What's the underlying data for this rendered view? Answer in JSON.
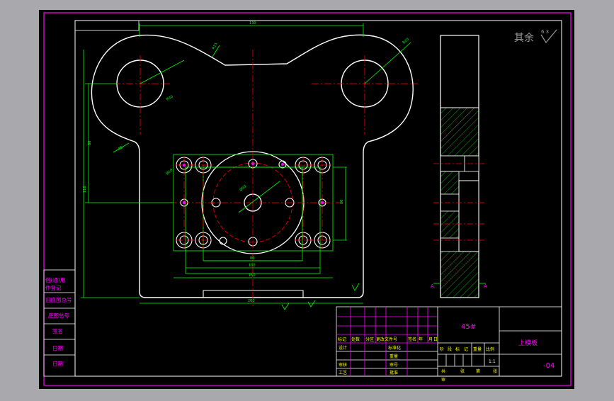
{
  "drawing": {
    "surface_note": "其余",
    "roughness": "6.3",
    "material": "45#",
    "part_name": "上模板",
    "drawing_number": "-04",
    "scale": "1:1"
  },
  "side_labels": [
    "借(通)用",
    "件登记",
    "旧底图总号",
    "底图总号",
    "签名",
    "日期",
    "日期"
  ],
  "title_block": {
    "rev_headers": [
      "标记",
      "处数",
      "分区",
      "更改文件号",
      "签名",
      "年",
      "月",
      "日"
    ],
    "left_rows": [
      "设计",
      "审核",
      "工艺"
    ],
    "mid_rows": [
      "标准化",
      "重量",
      "审号",
      "批准"
    ],
    "right_headers": [
      "阶",
      "段",
      "标",
      "记",
      "重量",
      "比例"
    ],
    "sheets": [
      "共",
      "张",
      "第",
      "张"
    ],
    "extra": "审"
  },
  "dims": {
    "top_width": "130",
    "r_arc_left": "R15",
    "r_arc_right": "R20",
    "r_circle_left": "R40",
    "r_corner": "R5",
    "left_height_top": "86",
    "left_height_total": "116",
    "center_dia": "Ø50",
    "hole_dia": "Ø10",
    "bottom_w1": "80",
    "bottom_w2": "130",
    "bottom_w3": "150",
    "bottom_w4": "200",
    "right_h": "80",
    "section_a": "A",
    "section_b": "A"
  },
  "colors": {
    "frame": "#ff00ff",
    "outline": "#ffffff",
    "dimension": "#00ff00",
    "center": "#ff0000",
    "hatch": "#00ff00",
    "text_magenta": "#ff00ff",
    "text_yellow": "#ffff00",
    "note_gray": "#9a9a9a"
  }
}
